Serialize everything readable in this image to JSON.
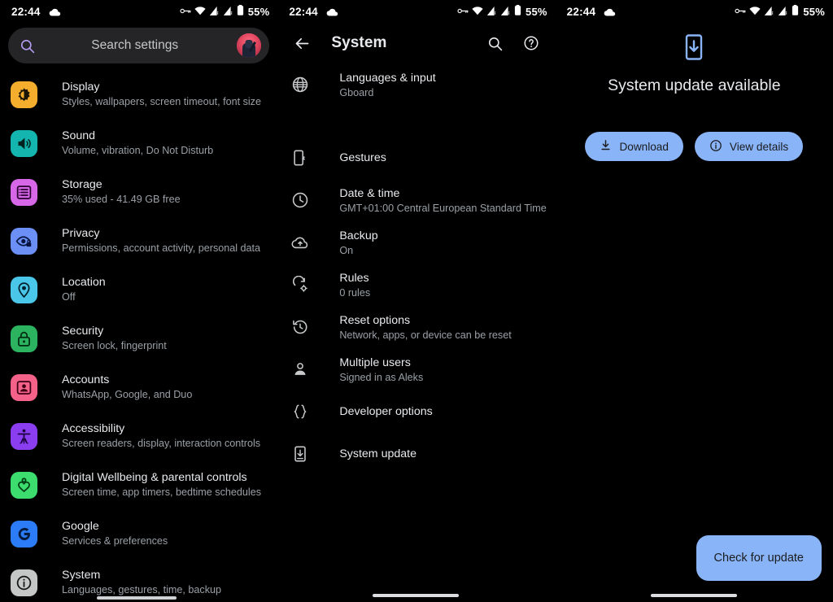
{
  "status_bar": {
    "time": "22:44",
    "cloud_icon": "cloud-icon",
    "vpn_icon": "vpn-key-icon",
    "wifi_icon": "wifi-icon",
    "signal_icon_1": "signal-bars-icon",
    "signal_icon_2": "signal-bars-icon",
    "battery_icon": "battery-icon",
    "battery_percent": "55%"
  },
  "left_panel": {
    "search": {
      "icon": "search-icon",
      "placeholder": "Search settings",
      "avatar": "user-avatar"
    },
    "items": [
      {
        "title": "Display",
        "subtitle": "Styles, wallpapers, screen timeout, font size",
        "icon": "brightness-icon",
        "color": "#f5ad2e"
      },
      {
        "title": "Sound",
        "subtitle": "Volume, vibration, Do Not Disturb",
        "icon": "volume-icon",
        "color": "#13b5ae"
      },
      {
        "title": "Storage",
        "subtitle": "35% used - 41.49 GB free",
        "icon": "storage-icon",
        "color": "#d668e8"
      },
      {
        "title": "Privacy",
        "subtitle": "Permissions, account activity, personal data",
        "icon": "privacy-eye-icon",
        "color": "#6b8ff5"
      },
      {
        "title": "Location",
        "subtitle": "Off",
        "icon": "location-pin-icon",
        "color": "#4ac6e8"
      },
      {
        "title": "Security",
        "subtitle": "Screen lock, fingerprint",
        "icon": "lock-icon",
        "color": "#2bb35f"
      },
      {
        "title": "Accounts",
        "subtitle": "WhatsApp, Google, and Duo",
        "icon": "accounts-icon",
        "color": "#f4628a"
      },
      {
        "title": "Accessibility",
        "subtitle": "Screen readers, display, interaction controls",
        "icon": "accessibility-icon",
        "color": "#8a3ef0"
      },
      {
        "title": "Digital Wellbeing & parental controls",
        "subtitle": "Screen time, app timers, bedtime schedules",
        "icon": "wellbeing-heart-icon",
        "color": "#3ddc6e"
      },
      {
        "title": "Google",
        "subtitle": "Services & preferences",
        "icon": "google-g-icon",
        "color": "#2b7cf6"
      },
      {
        "title": "System",
        "subtitle": "Languages, gestures, time, backup",
        "icon": "info-icon",
        "color": "#c4c7c5"
      }
    ]
  },
  "mid_panel": {
    "header": {
      "back_icon": "back-arrow-icon",
      "title": "System",
      "search_icon": "search-icon",
      "help_icon": "help-circle-icon"
    },
    "items": [
      {
        "title": "Languages & input",
        "subtitle": "Gboard",
        "icon": "globe-icon"
      },
      {
        "title": "Gestures",
        "subtitle": "",
        "icon": "gestures-phone-icon"
      },
      {
        "title": "Date & time",
        "subtitle": "GMT+01:00 Central European Standard Time",
        "icon": "clock-icon"
      },
      {
        "title": "Backup",
        "subtitle": "On",
        "icon": "cloud-upload-icon"
      },
      {
        "title": "Rules",
        "subtitle": "0 rules",
        "icon": "rules-gear-icon"
      },
      {
        "title": "Reset options",
        "subtitle": "Network, apps, or device can be reset",
        "icon": "reset-history-icon"
      },
      {
        "title": "Multiple users",
        "subtitle": "Signed in as Aleks",
        "icon": "person-icon"
      },
      {
        "title": "Developer options",
        "subtitle": "",
        "icon": "braces-icon"
      },
      {
        "title": "System update",
        "subtitle": "",
        "icon": "system-update-icon"
      }
    ]
  },
  "right_panel": {
    "update_icon": "system-update-phone-icon",
    "title": "System update available",
    "download_button": {
      "label": "Download",
      "icon": "download-icon"
    },
    "view_details_button": {
      "label": "View details",
      "icon": "info-circle-icon"
    },
    "check_button": {
      "label": "Check for update"
    }
  },
  "theme": {
    "accent": "#8ab4f8",
    "background": "#000000",
    "text_primary": "#e8eaed",
    "text_secondary": "#9aa0a6",
    "search_bg": "#252528",
    "search_icon_color": "#b79df5"
  }
}
